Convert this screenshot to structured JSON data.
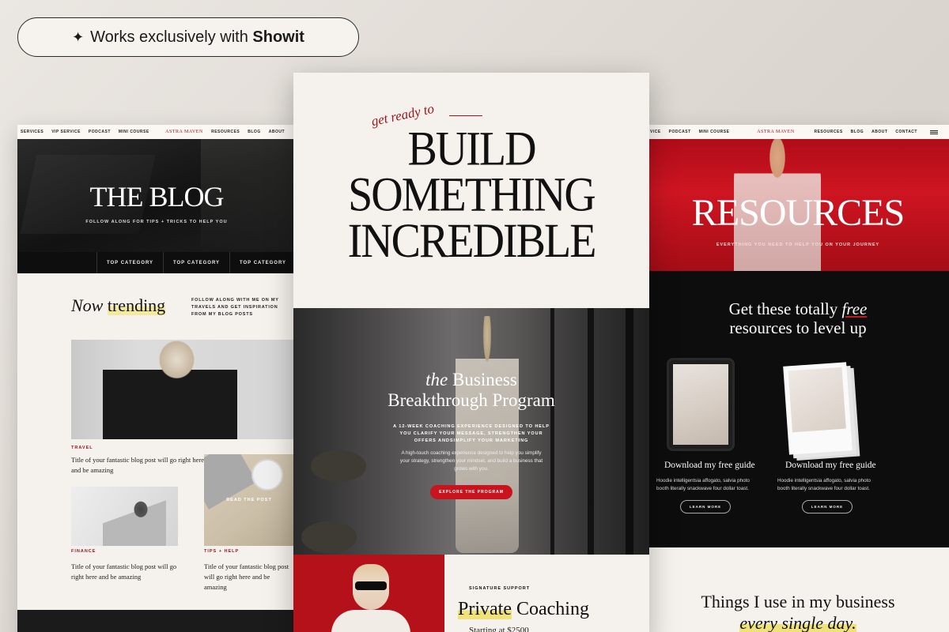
{
  "badge": {
    "prefix": "Works exclusively with ",
    "brand": "Showit",
    "icon": "sparkle-icon"
  },
  "left": {
    "nav": {
      "items_left": [
        "SERVICES",
        "VIP SERVICE",
        "PODCAST",
        "MINI COURSE"
      ],
      "logo": "ASTRA MAVEN",
      "items_right": [
        "RESOURCES",
        "BLOG",
        "ABOUT"
      ]
    },
    "hero_title": "THE BLOG",
    "hero_sub": "FOLLOW ALONG FOR TIPS + TRICKS TO HELP YOU",
    "categories": [
      "TOP CATEGORY",
      "TOP CATEGORY",
      "TOP CATEGORY"
    ],
    "trending_italic": "Now",
    "trending_word": "trending",
    "trending_note": "FOLLOW ALONG WITH ME ON MY TRAVELS AND GET INSPIRATION FROM MY BLOG POSTS",
    "posts": [
      {
        "tag": "TRAVEL",
        "title": "Title of your fantastic blog post will go right here and be amazing"
      },
      {
        "tag": "FINANCE",
        "title": "Title of your fantastic blog post will go right here and be amazing"
      },
      {
        "tag": "TIPS + HELP",
        "title": "Title of your fantastic blog post will go right here and be amazing"
      }
    ],
    "read_post": "READ THE POST"
  },
  "center": {
    "get_ready": "get ready to",
    "headline": [
      "BUILD",
      "SOMETHING",
      "INCREDIBLE"
    ],
    "program_italic": "the",
    "program_line1": "Business",
    "program_line2": "Breakthrough Program",
    "program_caps": "A 12-WEEK COACHING EXPERIENCE DESIGNED TO HELP YOU CLARIFY YOUR MESSAGE, STRENGTHEN YOUR OFFERS ANDSIMPLIFY YOUR MARKETING",
    "program_body": "A high-touch coaching experience designed to help you simplify your strategy, strengthen your mindset, and build a business that grows with you.",
    "program_button": "EXPLORE THE PROGRAM",
    "signature": "SIGNATURE SUPPORT",
    "private_hl": "Private",
    "private_rest": " Coaching",
    "starting": "Starting at $2500"
  },
  "right": {
    "nav": {
      "items_left": [
        "VICE",
        "PODCAST",
        "MINI COURSE"
      ],
      "logo": "ASTRA MAVEN",
      "items_right": [
        "RESOURCES",
        "BLOG",
        "ABOUT",
        "CONTACT"
      ]
    },
    "hero_title": "RESOURCES",
    "hero_sub": "EVERYTHING YOU NEED TO HELP YOU ON YOUR JOURNEY",
    "free_line1a": "Get these totally ",
    "free_italic": "free",
    "free_line2": "resources to level up",
    "guides": [
      {
        "title": "Download my free guide",
        "desc": "Hoodie intelligentsia affogato, salvia photo booth literally snackwave four dollar toast.",
        "button": "LEARN MORE"
      },
      {
        "title": "Download my free guide",
        "desc": "Hoodie intelligentsia affogato, salvia photo booth literally snackwave four dollar toast.",
        "button": "LEARN MORE"
      }
    ],
    "things_line1": "Things I use in my business",
    "things_line2": "every single day."
  },
  "colors": {
    "brand_red": "#c8141c",
    "dark": "#0d0d0d",
    "cream": "#f5f1ec",
    "highlight": "#efe27b"
  }
}
